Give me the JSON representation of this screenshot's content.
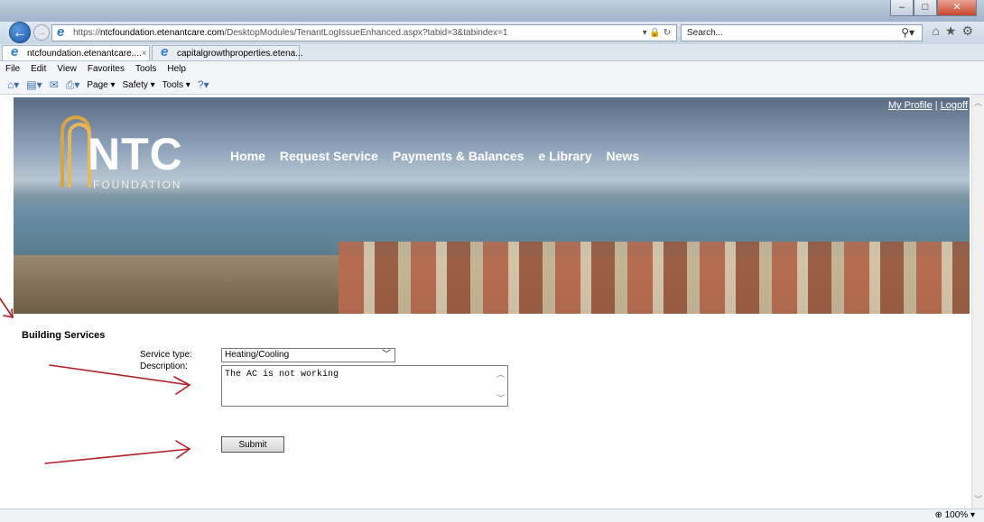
{
  "browser": {
    "url_prefix": "https://",
    "url_host": "ntcfoundation.etenantcare.com",
    "url_path": "/DesktopModules/TenantLogIssueEnhanced.aspx?tabid=3&tabindex=1",
    "search_placeholder": "Search...",
    "tabs": [
      {
        "label": "ntcfoundation.etenantcare....",
        "close": "×"
      },
      {
        "label": "capitalgrowthproperties.etena..."
      }
    ],
    "menu": [
      "File",
      "Edit",
      "View",
      "Favorites",
      "Tools",
      "Help"
    ],
    "commands": [
      "Page ▾",
      "Safety ▾",
      "Tools ▾"
    ],
    "zoom": "100%"
  },
  "site": {
    "logo_text": "NTC",
    "logo_sub": "FOUNDATION",
    "links": {
      "profile": "My Profile",
      "separator": "|",
      "logoff": "Logoff"
    },
    "nav": [
      "Home",
      "Request Service",
      "Payments & Balances",
      "e Library",
      "News"
    ]
  },
  "form": {
    "section_title": "Building Services",
    "service_type_label": "Service type:",
    "service_type_value": "Heating/Cooling",
    "description_label": "Description:",
    "description_value": "The AC is not working",
    "submit_label": "Submit"
  },
  "colors": {
    "annotation_arrow": "#b01e23",
    "logo_gold": "#d9a441"
  }
}
